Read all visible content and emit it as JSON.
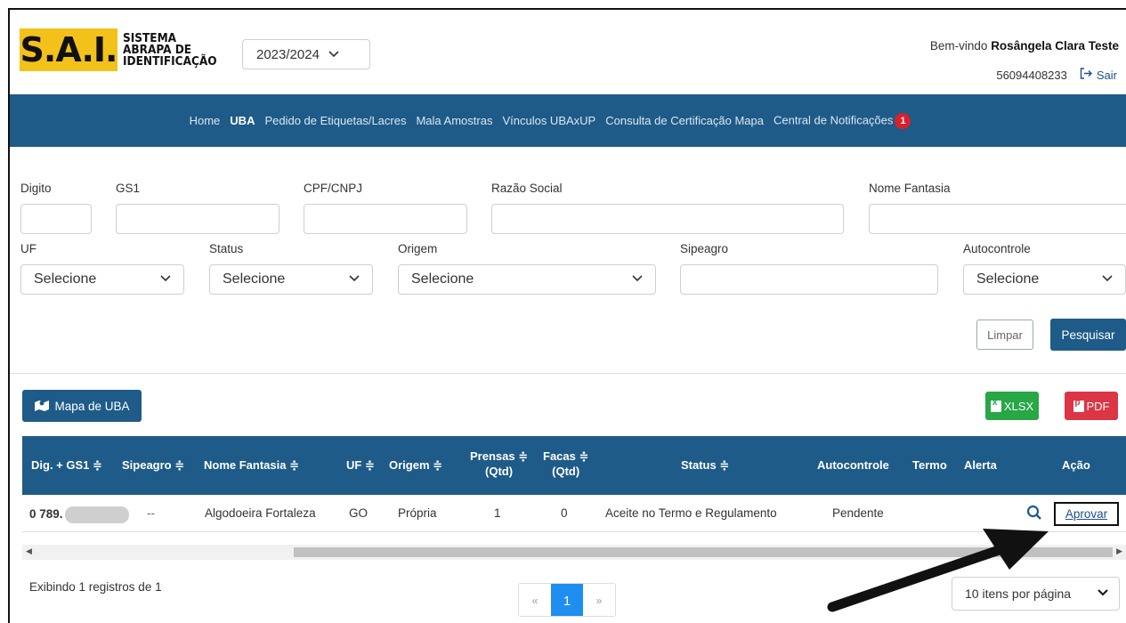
{
  "header": {
    "logo_letters": "S.A.I.",
    "logo_line1": "SISTEMA",
    "logo_line2": "ABRAPA DE",
    "logo_line3": "IDENTIFICAÇÃO",
    "year_value": "2023/2024",
    "welcome_prefix": "Bem-vindo",
    "user_name": "Rosângela Clara Teste",
    "user_id": "56094408233",
    "logout_label": "Sair"
  },
  "nav": {
    "items": [
      "Home",
      "UBA",
      "Pedido de Etiquetas/Lacres",
      "Mala Amostras",
      "Vínculos UBAxUP",
      "Consulta de Certificação Mapa",
      "Central de Notificações"
    ],
    "notif_count": "1"
  },
  "filters": {
    "digito_label": "Digito",
    "gs1_label": "GS1",
    "cpf_label": "CPF/CNPJ",
    "razao_label": "Razão Social",
    "fantasia_label": "Nome Fantasia",
    "uf_label": "UF",
    "uf_value": "Selecione",
    "status_label": "Status",
    "status_value": "Selecione",
    "origem_label": "Origem",
    "origem_value": "Selecione",
    "sipeagro_label": "Sipeagro",
    "autocontrole_label": "Autocontrole",
    "autocontrole_value": "Selecione",
    "clear_label": "Limpar",
    "search_label": "Pesquisar"
  },
  "actions": {
    "map_label": "Mapa de UBA",
    "xlsx_label": "XLSX",
    "pdf_label": "PDF"
  },
  "table": {
    "headers": {
      "dig": "Dig. + GS1 ≑",
      "sipeagro": "Sipeagro ≑",
      "fantasia": "Nome Fantasia ≑",
      "uf": "UF ≑",
      "origem": "Origem ≑",
      "prensas_1": "Prensas ≑",
      "prensas_2": "(Qtd)",
      "facas_1": "Facas ≑",
      "facas_2": "(Qtd)",
      "status": "Status ≑",
      "autocontrole": "Autocontrole",
      "termo": "Termo",
      "alerta": "Alerta",
      "acao": "Ação"
    },
    "rows": [
      {
        "dig": "0 789.",
        "sipeagro": "--",
        "fantasia": "Algodoeira Fortaleza",
        "uf": "GO",
        "origem": "Própria",
        "prensas": "1",
        "facas": "0",
        "status": "Aceite no Termo e Regulamento",
        "autocontrole": "Pendente",
        "action": "Aprovar"
      }
    ]
  },
  "footer": {
    "records_info": "Exibindo 1 registros de 1",
    "page_prev": "«",
    "page_current": "1",
    "page_next": "»",
    "per_page": "10 itens por página"
  },
  "colors": {
    "primary": "#1e5b88",
    "logo_yellow": "#f2c21b",
    "xlsx": "#27a745",
    "pdf": "#dc3545",
    "badge": "#d9202a"
  }
}
